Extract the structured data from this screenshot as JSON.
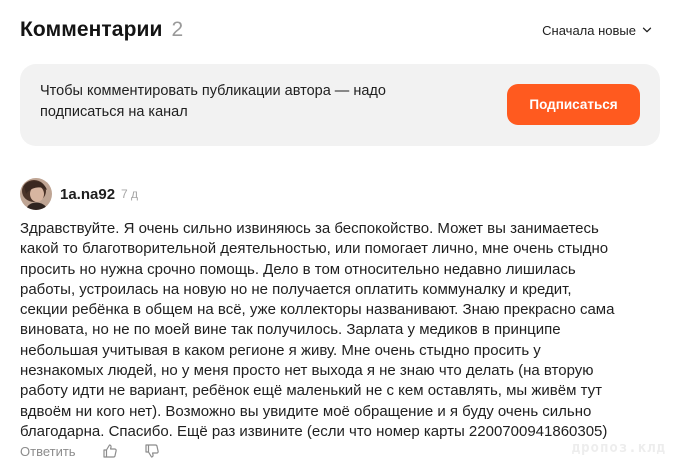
{
  "header": {
    "title": "Комментарии",
    "count": "2",
    "sort_label": "Сначала новые"
  },
  "banner": {
    "text": "Чтобы комментировать публикации автора — надо подписаться на канал",
    "button_label": "Подписаться"
  },
  "comment": {
    "author": "1a.na92",
    "time": "7 д",
    "text": "Здравствуйте. Я очень сильно извиняюсь за беспокойство. Может вы занимаетесь\nкакой то благотворительной деятельностью, или помогает лично, мне очень стыдно\nпросить но нужна срочно помощь. Дело в том относительно недавно лишилась\nработы, устроилась на новую но не получается оплатить коммуналку и кредит,\nсекции ребёнка в общем на всё, уже коллекторы названивают. Знаю прекрасно сама\nвиновата, но не по моей вине так получилось. Зарлата у медиков в принципе\nнебольшая учитывая в каком регионе я живу. Мне очень стыдно просить у\nнезнакомых людей, но у меня просто нет выхода я не знаю что делать (на вторую\nработу идти не вариант, ребёнок ещё маленький не с кем оставлять, мы живём тут\nвдвоём ни кого нет). Возможно вы увидите моё обращение и я буду очень сильно\nблагодарна. Спасибо. Ещё раз извините (если что номер карты 2200700941860305)"
  },
  "actions": {
    "reply_label": "Ответить"
  },
  "watermark": "дропоз.клд",
  "colors": {
    "accent": "#ff5a1f",
    "banner_bg": "#f2f2f2",
    "muted_text": "#9a9a9a"
  },
  "icons": {
    "sort": "chevron-down-icon",
    "like": "thumbs-up-icon",
    "dislike": "thumbs-down-icon"
  }
}
